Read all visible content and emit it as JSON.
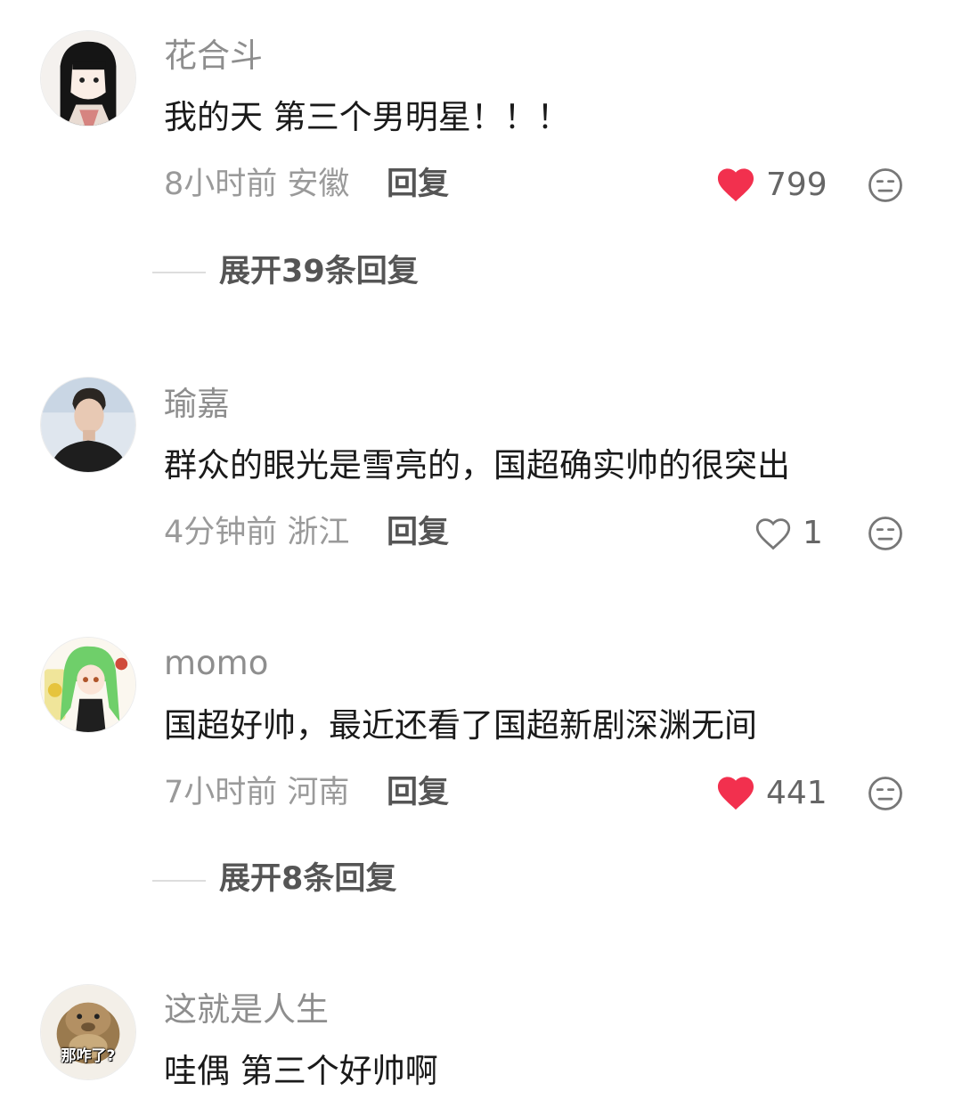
{
  "colors": {
    "like_red": "#f2304e",
    "username_gray": "#8e8e8e",
    "meta_gray": "#9a9a9a"
  },
  "comments": [
    {
      "username": "花合斗",
      "text": "我的天 第三个男明星！！！",
      "meta": "8小时前 安徽",
      "reply_label": "回复",
      "likes": "799",
      "liked": true,
      "expand_label": "展开39条回复"
    },
    {
      "username": "瑜嘉",
      "text": "群众的眼光是雪亮的，国超确实帅的很突出",
      "meta": "4分钟前 浙江",
      "reply_label": "回复",
      "likes": "1",
      "liked": false
    },
    {
      "username": "momo",
      "text": "国超好帅，最近还看了国超新剧深渊无间",
      "meta": "7小时前 河南",
      "reply_label": "回复",
      "likes": "441",
      "liked": true,
      "expand_label": "展开8条回复"
    },
    {
      "username": "这就是人生",
      "text": "哇偶 第三个好帅啊",
      "avatar_caption": "那咋了?"
    }
  ]
}
